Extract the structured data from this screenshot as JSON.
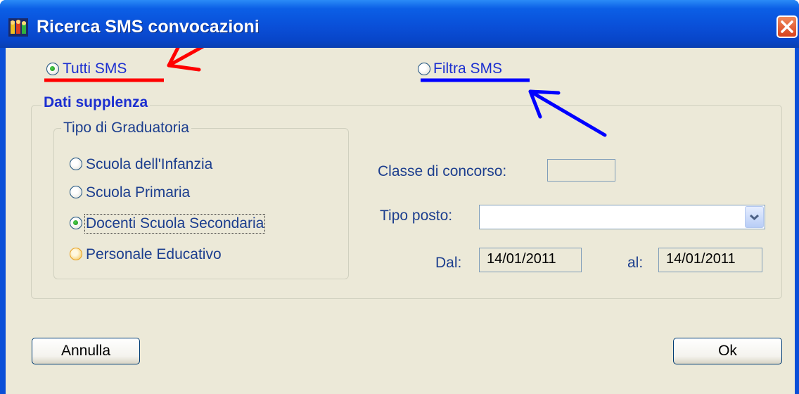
{
  "window": {
    "title": "Ricerca SMS convocazioni"
  },
  "mode": {
    "all_label": "Tutti SMS",
    "filter_label": "Filtra SMS",
    "selected": "all"
  },
  "dati_supplenza": {
    "title": "Dati supplenza",
    "tipo_graduatoria": {
      "title": "Tipo di Graduatoria",
      "options": [
        {
          "label": "Scuola dell'Infanzia"
        },
        {
          "label": "Scuola Primaria"
        },
        {
          "label": "Docenti Scuola Secondaria"
        },
        {
          "label": "Personale Educativo"
        }
      ],
      "selected": "Docenti Scuola Secondaria"
    },
    "classe_concorso": {
      "label": "Classe di concorso:",
      "value": ""
    },
    "tipo_posto": {
      "label": "Tipo posto:",
      "value": ""
    },
    "dal": {
      "label": "Dal:",
      "value": "14/01/2011"
    },
    "al": {
      "label": "al:",
      "value": "14/01/2011"
    }
  },
  "buttons": {
    "cancel": "Annulla",
    "ok": "Ok"
  },
  "icons": {
    "app": "app-icon",
    "close": "close-icon",
    "dropdown": "chevron-down-icon"
  },
  "annotation_colors": {
    "red": "#ff0000",
    "blue": "#0000ff"
  }
}
